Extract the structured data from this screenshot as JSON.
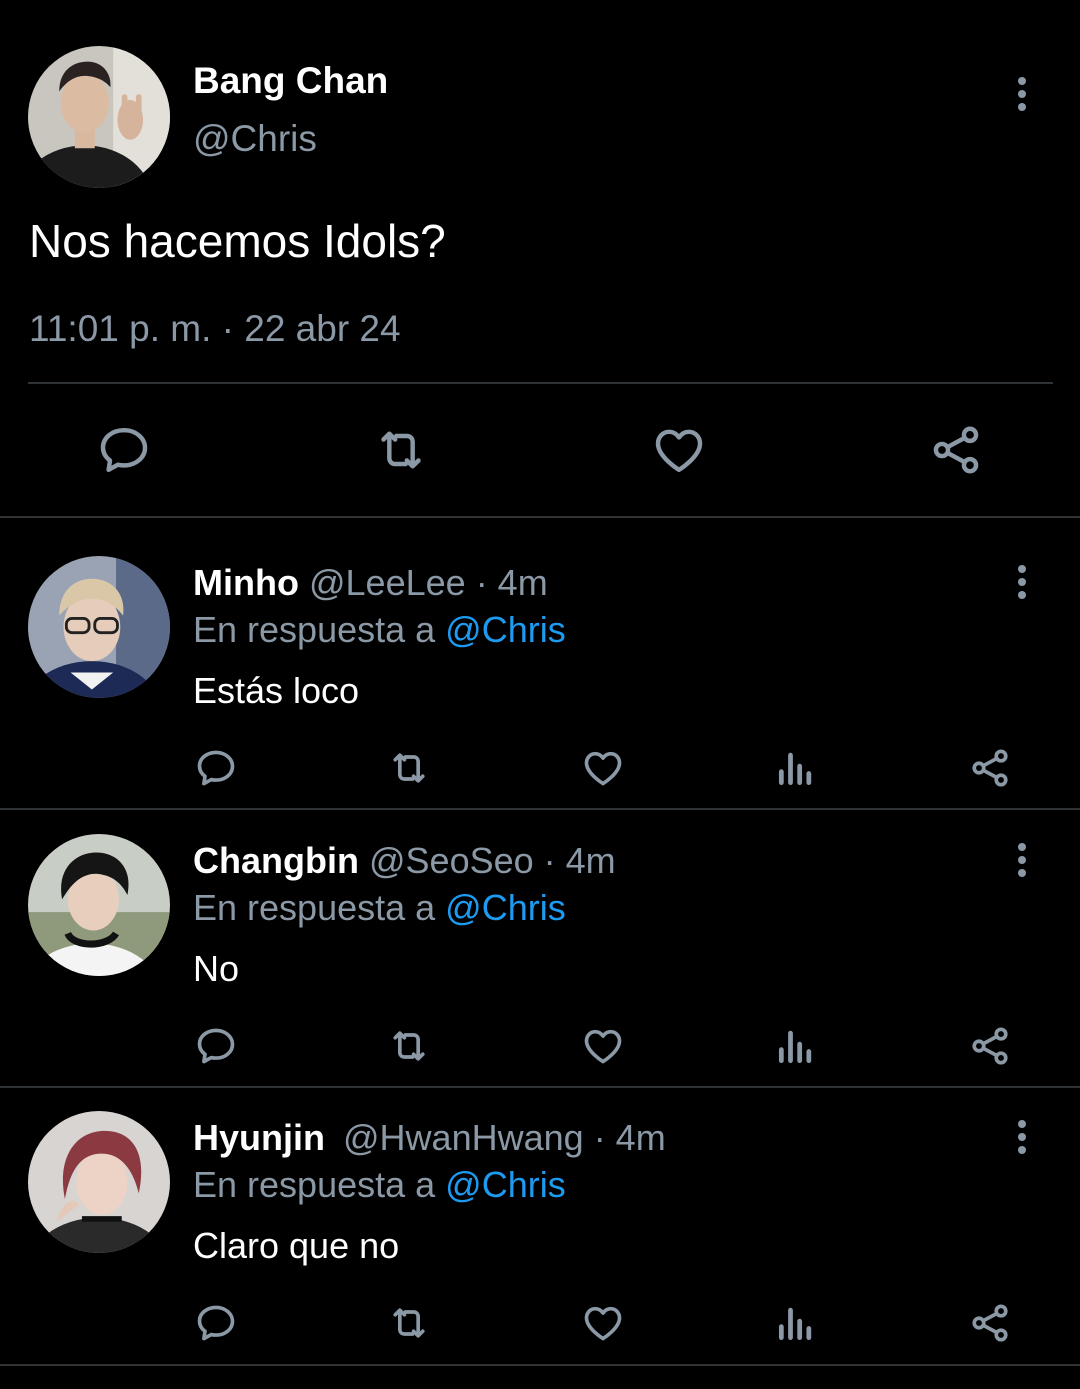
{
  "main_tweet": {
    "author_name": "Bang Chan",
    "author_handle": "@Chris",
    "text": "Nos hacemos Idols?",
    "timestamp": "11:01 p. m. · 22 abr 24",
    "actions": [
      "reply-icon",
      "retweet-icon",
      "like-icon",
      "share-icon"
    ]
  },
  "replies": [
    {
      "author_name": "Minho",
      "author_handle": "@LeeLee",
      "time": "· 4m",
      "reply_prefix": "En respuesta a",
      "reply_to": "@Chris",
      "text": "Estás loco"
    },
    {
      "author_name": "Changbin",
      "author_handle": "@SeoSeo",
      "time": "· 4m",
      "reply_prefix": "En respuesta a",
      "reply_to": "@Chris",
      "text": "No"
    },
    {
      "author_name": "Hyunjin",
      "author_handle": "@HwanHwang",
      "time": "· 4m",
      "reply_prefix": "En respuesta a",
      "reply_to": "@Chris",
      "text": "Claro que no"
    }
  ],
  "reply_actions": [
    "reply-icon",
    "retweet-icon",
    "like-icon",
    "views-icon",
    "share-icon"
  ],
  "colors": {
    "background": "#000000",
    "text_primary": "#ffffff",
    "text_secondary": "#8b98a5",
    "link": "#1d9bf0",
    "divider": "#2f3336"
  }
}
